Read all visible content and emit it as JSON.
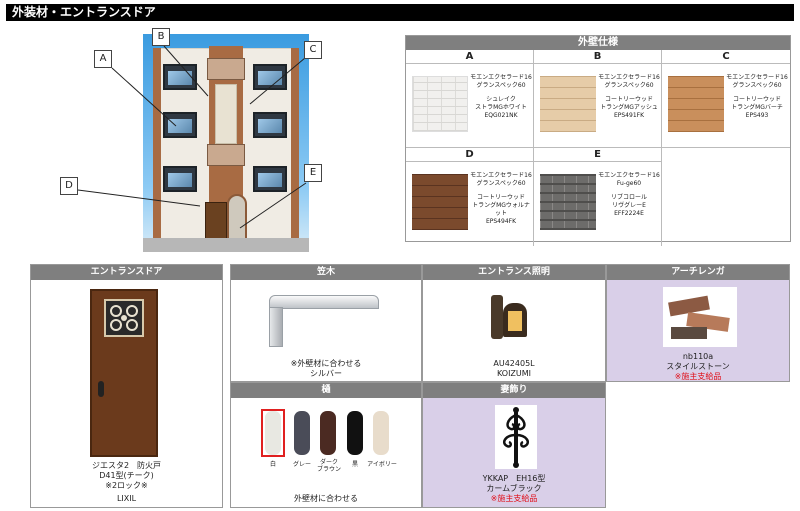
{
  "title": "外装材・エントランスドア",
  "callouts": [
    "A",
    "B",
    "C",
    "D",
    "E"
  ],
  "wall_spec": {
    "header": "外壁仕様",
    "columns": [
      "A",
      "B",
      "C"
    ],
    "row2_columns": [
      "D",
      "E",
      ""
    ],
    "items": [
      {
        "key": "A",
        "line1": "モエンエクセラード16",
        "line2": "グランスペック60",
        "line3": "シュレイク",
        "line4": "ストラMGホワイト",
        "line5": "EQG021NK",
        "color": "#f1f0ee"
      },
      {
        "key": "B",
        "line1": "モエンエクセラード16",
        "line2": "グランスペック60",
        "line3": "コートリーウッド",
        "line4": "トラングMGアッシュ",
        "line5": "EPS491FK",
        "color": "#e6cca8"
      },
      {
        "key": "C",
        "line1": "モエンエクセラード16",
        "line2": "グランスペック60",
        "line3": "コートリーウッド",
        "line4": "トラングMGバーチ",
        "line5": "EPS493",
        "color": "#c98f5c"
      },
      {
        "key": "D",
        "line1": "モエンエクセラード16",
        "line2": "グランスペック60",
        "line3": "コートリーウッド",
        "line4": "トラングMGウォルナット",
        "line5": "EPS494FK",
        "color": "#7b4a2d"
      },
      {
        "key": "E",
        "line1": "モエンエクセラード16",
        "line2": "Fu-ge60",
        "line3": "リブコロール",
        "line4": "リヴグレーE",
        "line5": "EFF2224E",
        "color": "#6d6c6a"
      }
    ]
  },
  "entrance_door": {
    "header": "エントランスドア",
    "line1": "ジエスタ2　防火戸",
    "line2": "D41型(チーク)",
    "line3": "※2ロック※",
    "line4": "LIXIL"
  },
  "kasagi": {
    "header": "笠木",
    "note": "※外壁材に合わせる",
    "color_name": "シルバー"
  },
  "entrance_light": {
    "header": "エントランス照明",
    "model": "AU42405L",
    "maker": "KOIZUMI"
  },
  "arch_brick": {
    "header": "アーチレンガ",
    "model": "nb110a",
    "name": "スタイルストーン",
    "note": "※施主支給品"
  },
  "toi": {
    "header": "樋",
    "swatches": [
      {
        "label": "白",
        "color": "#e8e8e2"
      },
      {
        "label": "グレー",
        "color": "#4a4c58"
      },
      {
        "label": "ダーク\nブラウン",
        "color": "#4b2a22"
      },
      {
        "label": "黒",
        "color": "#111111"
      },
      {
        "label": "アイボリー",
        "color": "#e8dccb"
      }
    ],
    "note": "外壁材に合わせる"
  },
  "tsumakazari": {
    "header": "妻飾り",
    "model": "YKKAP　EH16型",
    "name": "カームブラック",
    "note": "※施主支給品"
  }
}
